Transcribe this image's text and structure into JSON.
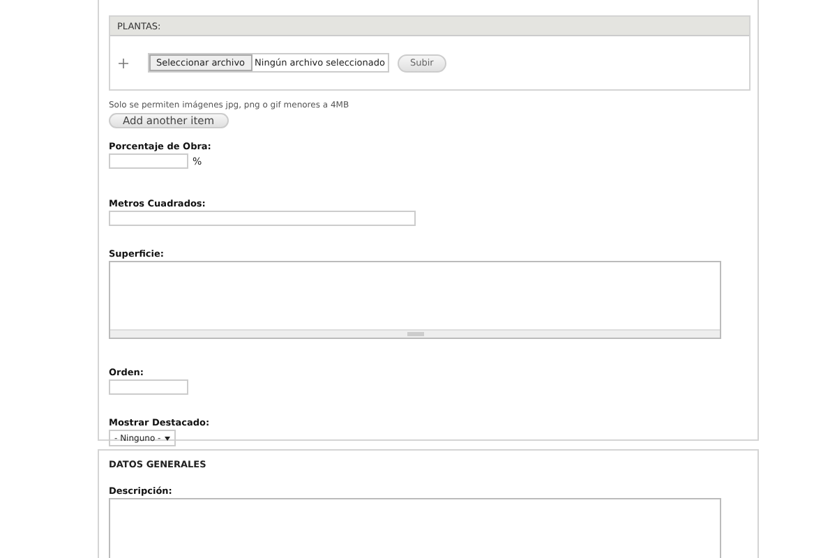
{
  "section_main": {
    "plantas": {
      "header": "PLANTAS:",
      "file_button": "Seleccionar archivo",
      "file_status": "Ningún archivo seleccionado",
      "upload_button": "Subir"
    },
    "help": "Solo se permiten imágenes jpg, png o gif menores a 4MB",
    "add_button": "Add another item",
    "fields": [
      {
        "kind": "short",
        "label": "Porcentaje de Obra:",
        "suffix": "%"
      },
      {
        "kind": "long",
        "label": "Metros Cuadrados:"
      },
      {
        "kind": "textarea",
        "label": "Superficie:"
      },
      {
        "kind": "short",
        "label": "Orden:"
      },
      {
        "kind": "select",
        "label": "Mostrar Destacado:",
        "value": "- Ninguno -"
      }
    ]
  },
  "section_general": {
    "title": "DATOS GENERALES",
    "fields": [
      {
        "kind": "textarea",
        "label": "Descripción:"
      }
    ]
  }
}
